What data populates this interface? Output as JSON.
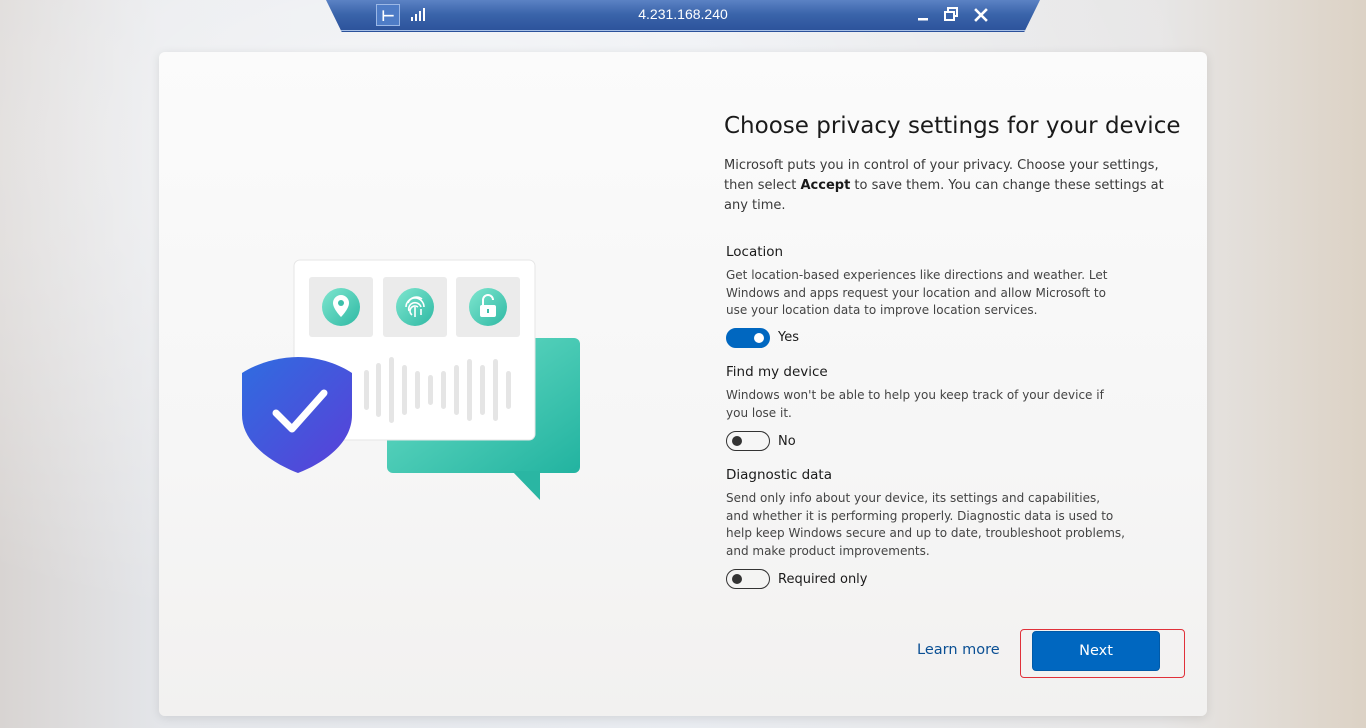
{
  "rdp_bar": {
    "title": "4.231.168.240",
    "pin_icon": "pin-icon",
    "signal_icon": "signal-strength-icon",
    "minimize_icon": "minimize-icon",
    "restore_icon": "restore-icon",
    "close_icon": "close-icon"
  },
  "oobe": {
    "title": "Choose privacy settings for your device",
    "intro_part1": "Microsoft puts you in control of your privacy. Choose your settings, then select ",
    "intro_bold": "Accept",
    "intro_part2": " to save them. You can change these settings at any time.",
    "settings": [
      {
        "label": "Location",
        "description": "Get location-based experiences like directions and weather. Let Windows and apps request your location and allow Microsoft to use your location data to improve location services.",
        "state": "Yes",
        "on": true
      },
      {
        "label": "Find my device",
        "description": "Windows won't be able to help you keep track of your device if you lose it.",
        "state": "No",
        "on": false
      },
      {
        "label": "Diagnostic data",
        "description": "Send only info about your device, its settings and capabilities, and whether it is performing properly. Diagnostic data is used to help keep Windows secure and up to date, troubleshoot problems, and make product improvements.",
        "state": "Required only",
        "on": false
      }
    ],
    "learn_more": "Learn more",
    "next": "Next"
  },
  "colors": {
    "accent": "#0067c0",
    "highlight": "#e0313a",
    "rdp_bar": "#3a64aa"
  }
}
